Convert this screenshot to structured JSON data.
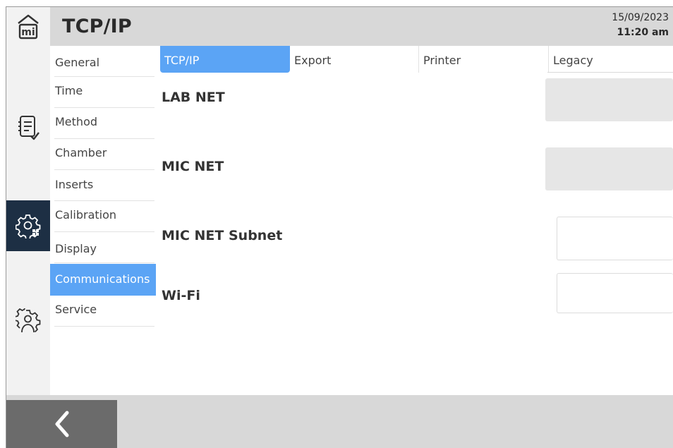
{
  "header": {
    "title": "TCP/IP",
    "date": "15/09/2023",
    "time": "11:20 am"
  },
  "rail": {
    "logo_text": "mi",
    "icons": [
      "home-icon",
      "checklist-icon",
      "settings-gear-icon",
      "user-gear-icon"
    ]
  },
  "submenu": {
    "items": [
      {
        "label": "General"
      },
      {
        "label": "Time"
      },
      {
        "label": "Method"
      },
      {
        "label": "Chamber"
      },
      {
        "label": "Inserts"
      },
      {
        "label": "Calibration"
      },
      {
        "label": "Display"
      },
      {
        "label": "Communications"
      },
      {
        "label": "Service"
      }
    ],
    "active": "Communications"
  },
  "tabs": {
    "items": [
      {
        "label": "TCP/IP"
      },
      {
        "label": "Export"
      },
      {
        "label": "Printer"
      },
      {
        "label": "Legacy"
      }
    ],
    "active": "TCP/IP"
  },
  "rows": [
    {
      "label": "LAB NET",
      "value": ""
    },
    {
      "label": "MIC NET",
      "value": ""
    },
    {
      "label": "MIC NET Subnet",
      "value": ""
    },
    {
      "label": "Wi-Fi",
      "value": ""
    }
  ],
  "footer": {
    "back_icon": "chevron-left-icon"
  },
  "colors": {
    "accent": "#5ba4f5",
    "rail_active": "#1d2f44",
    "header_bg": "#d8d8d8",
    "back_button": "#6b6b6b"
  }
}
